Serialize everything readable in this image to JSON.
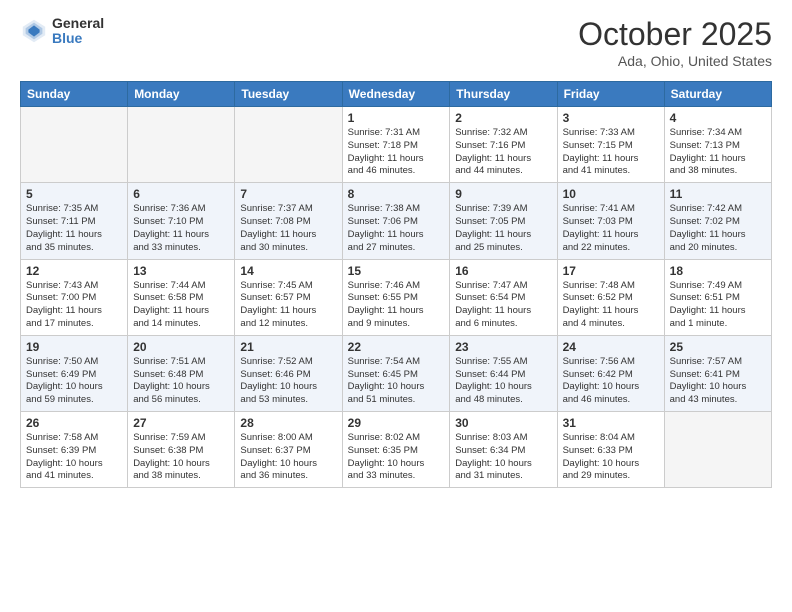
{
  "header": {
    "logo_general": "General",
    "logo_blue": "Blue",
    "month_title": "October 2025",
    "location": "Ada, Ohio, United States"
  },
  "weekdays": [
    "Sunday",
    "Monday",
    "Tuesday",
    "Wednesday",
    "Thursday",
    "Friday",
    "Saturday"
  ],
  "weeks": [
    [
      {
        "day": "",
        "info": ""
      },
      {
        "day": "",
        "info": ""
      },
      {
        "day": "",
        "info": ""
      },
      {
        "day": "1",
        "info": "Sunrise: 7:31 AM\nSunset: 7:18 PM\nDaylight: 11 hours\nand 46 minutes."
      },
      {
        "day": "2",
        "info": "Sunrise: 7:32 AM\nSunset: 7:16 PM\nDaylight: 11 hours\nand 44 minutes."
      },
      {
        "day": "3",
        "info": "Sunrise: 7:33 AM\nSunset: 7:15 PM\nDaylight: 11 hours\nand 41 minutes."
      },
      {
        "day": "4",
        "info": "Sunrise: 7:34 AM\nSunset: 7:13 PM\nDaylight: 11 hours\nand 38 minutes."
      }
    ],
    [
      {
        "day": "5",
        "info": "Sunrise: 7:35 AM\nSunset: 7:11 PM\nDaylight: 11 hours\nand 35 minutes."
      },
      {
        "day": "6",
        "info": "Sunrise: 7:36 AM\nSunset: 7:10 PM\nDaylight: 11 hours\nand 33 minutes."
      },
      {
        "day": "7",
        "info": "Sunrise: 7:37 AM\nSunset: 7:08 PM\nDaylight: 11 hours\nand 30 minutes."
      },
      {
        "day": "8",
        "info": "Sunrise: 7:38 AM\nSunset: 7:06 PM\nDaylight: 11 hours\nand 27 minutes."
      },
      {
        "day": "9",
        "info": "Sunrise: 7:39 AM\nSunset: 7:05 PM\nDaylight: 11 hours\nand 25 minutes."
      },
      {
        "day": "10",
        "info": "Sunrise: 7:41 AM\nSunset: 7:03 PM\nDaylight: 11 hours\nand 22 minutes."
      },
      {
        "day": "11",
        "info": "Sunrise: 7:42 AM\nSunset: 7:02 PM\nDaylight: 11 hours\nand 20 minutes."
      }
    ],
    [
      {
        "day": "12",
        "info": "Sunrise: 7:43 AM\nSunset: 7:00 PM\nDaylight: 11 hours\nand 17 minutes."
      },
      {
        "day": "13",
        "info": "Sunrise: 7:44 AM\nSunset: 6:58 PM\nDaylight: 11 hours\nand 14 minutes."
      },
      {
        "day": "14",
        "info": "Sunrise: 7:45 AM\nSunset: 6:57 PM\nDaylight: 11 hours\nand 12 minutes."
      },
      {
        "day": "15",
        "info": "Sunrise: 7:46 AM\nSunset: 6:55 PM\nDaylight: 11 hours\nand 9 minutes."
      },
      {
        "day": "16",
        "info": "Sunrise: 7:47 AM\nSunset: 6:54 PM\nDaylight: 11 hours\nand 6 minutes."
      },
      {
        "day": "17",
        "info": "Sunrise: 7:48 AM\nSunset: 6:52 PM\nDaylight: 11 hours\nand 4 minutes."
      },
      {
        "day": "18",
        "info": "Sunrise: 7:49 AM\nSunset: 6:51 PM\nDaylight: 11 hours\nand 1 minute."
      }
    ],
    [
      {
        "day": "19",
        "info": "Sunrise: 7:50 AM\nSunset: 6:49 PM\nDaylight: 10 hours\nand 59 minutes."
      },
      {
        "day": "20",
        "info": "Sunrise: 7:51 AM\nSunset: 6:48 PM\nDaylight: 10 hours\nand 56 minutes."
      },
      {
        "day": "21",
        "info": "Sunrise: 7:52 AM\nSunset: 6:46 PM\nDaylight: 10 hours\nand 53 minutes."
      },
      {
        "day": "22",
        "info": "Sunrise: 7:54 AM\nSunset: 6:45 PM\nDaylight: 10 hours\nand 51 minutes."
      },
      {
        "day": "23",
        "info": "Sunrise: 7:55 AM\nSunset: 6:44 PM\nDaylight: 10 hours\nand 48 minutes."
      },
      {
        "day": "24",
        "info": "Sunrise: 7:56 AM\nSunset: 6:42 PM\nDaylight: 10 hours\nand 46 minutes."
      },
      {
        "day": "25",
        "info": "Sunrise: 7:57 AM\nSunset: 6:41 PM\nDaylight: 10 hours\nand 43 minutes."
      }
    ],
    [
      {
        "day": "26",
        "info": "Sunrise: 7:58 AM\nSunset: 6:39 PM\nDaylight: 10 hours\nand 41 minutes."
      },
      {
        "day": "27",
        "info": "Sunrise: 7:59 AM\nSunset: 6:38 PM\nDaylight: 10 hours\nand 38 minutes."
      },
      {
        "day": "28",
        "info": "Sunrise: 8:00 AM\nSunset: 6:37 PM\nDaylight: 10 hours\nand 36 minutes."
      },
      {
        "day": "29",
        "info": "Sunrise: 8:02 AM\nSunset: 6:35 PM\nDaylight: 10 hours\nand 33 minutes."
      },
      {
        "day": "30",
        "info": "Sunrise: 8:03 AM\nSunset: 6:34 PM\nDaylight: 10 hours\nand 31 minutes."
      },
      {
        "day": "31",
        "info": "Sunrise: 8:04 AM\nSunset: 6:33 PM\nDaylight: 10 hours\nand 29 minutes."
      },
      {
        "day": "",
        "info": ""
      }
    ]
  ]
}
